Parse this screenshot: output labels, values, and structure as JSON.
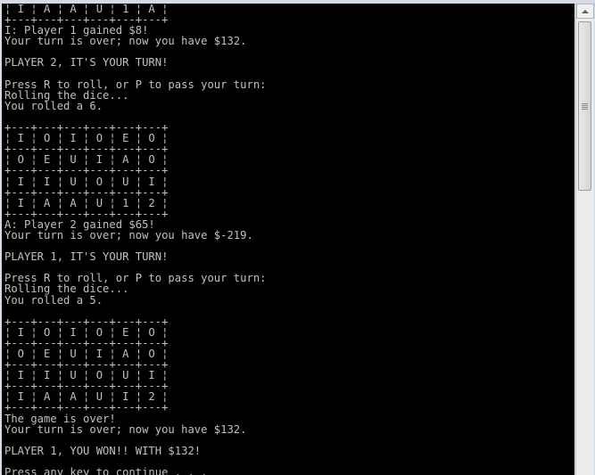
{
  "console": {
    "lines": [
      "¦ I ¦ A ¦ A ¦ U ¦ 1 ¦ A ¦",
      "+---+---+---+---+---+---+",
      "I: Player 1 gained $8!",
      "Your turn is over; now you have $132.",
      "",
      "PLAYER 2, IT'S YOUR TURN!",
      "",
      "Press R to roll, or P to pass your turn:",
      "Rolling the dice...",
      "You rolled a 6.",
      "",
      "+---+---+---+---+---+---+",
      "¦ I ¦ O ¦ I ¦ O ¦ E ¦ O ¦",
      "+---+---+---+---+---+---+",
      "¦ O ¦ E ¦ U ¦ I ¦ A ¦ O ¦",
      "+---+---+---+---+---+---+",
      "¦ I ¦ I ¦ U ¦ O ¦ U ¦ I ¦",
      "+---+---+---+---+---+---+",
      "¦ I ¦ A ¦ A ¦ U ¦ 1 ¦ 2 ¦",
      "+---+---+---+---+---+---+",
      "A: Player 2 gained $65!",
      "Your turn is over; now you have $-219.",
      "",
      "PLAYER 1, IT'S YOUR TURN!",
      "",
      "Press R to roll, or P to pass your turn:",
      "Rolling the dice...",
      "You rolled a 5.",
      "",
      "+---+---+---+---+---+---+",
      "¦ I ¦ O ¦ I ¦ O ¦ E ¦ O ¦",
      "+---+---+---+---+---+---+",
      "¦ O ¦ E ¦ U ¦ I ¦ A ¦ O ¦",
      "+---+---+---+---+---+---+",
      "¦ I ¦ I ¦ U ¦ O ¦ U ¦ I ¦",
      "+---+---+---+---+---+---+",
      "¦ I ¦ A ¦ A ¦ U ¦ I ¦ 2 ¦",
      "+---+---+---+---+---+---+",
      "The game is over!",
      "Your turn is over; now you have $132.",
      "",
      "PLAYER 1, YOU WON!! WITH $132!",
      "",
      "Press any key to continue . . ."
    ]
  },
  "colors": {
    "console_background": "#000000",
    "console_text": "#c0c0c0"
  },
  "scrollbar": {
    "up_icon": "triangle-up-icon",
    "grip_icon": "grip-lines-icon"
  }
}
